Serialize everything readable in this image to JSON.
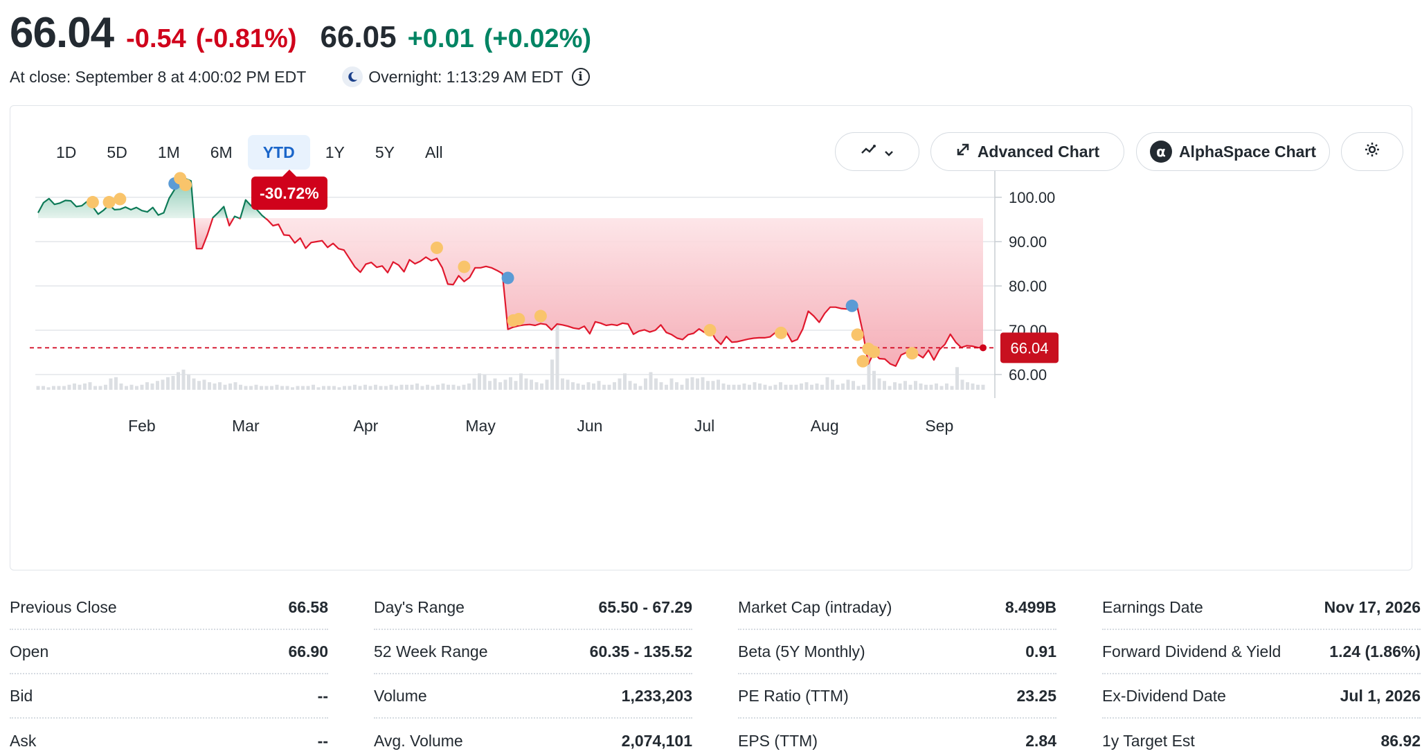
{
  "quote": {
    "price": "66.04",
    "change": "-0.54",
    "change_pct": "(-0.81%)",
    "overnight_price": "66.05",
    "overnight_change": "+0.01",
    "overnight_change_pct": "(+0.02%)",
    "close_text": "At close: September 8 at 4:00:02 PM EDT",
    "overnight_text": "Overnight: 1:13:29 AM EDT"
  },
  "range_tabs": [
    {
      "label": "1D",
      "active": false
    },
    {
      "label": "5D",
      "active": false
    },
    {
      "label": "1M",
      "active": false
    },
    {
      "label": "6M",
      "active": false
    },
    {
      "label": "YTD",
      "active": true
    },
    {
      "label": "1Y",
      "active": false
    },
    {
      "label": "5Y",
      "active": false
    },
    {
      "label": "All",
      "active": false
    }
  ],
  "toolbar": {
    "advanced_label": "Advanced Chart",
    "alpha_label": "AlphaSpace Chart",
    "alpha_glyph": "α",
    "chart_type_icon": "chart-type-icon",
    "settings_icon": "gear-icon"
  },
  "badge": {
    "text": "-30.72%"
  },
  "colors": {
    "negative": "#d0021b",
    "positive": "#008463",
    "active_tab": "#1a65c9",
    "event_yellow": "#f9c46b",
    "event_blue": "#5b9bd5"
  },
  "chart_data": {
    "type": "area",
    "title": "",
    "xlabel": "",
    "ylabel": "",
    "y_ticks": [
      "100.00",
      "90.00",
      "80.00",
      "70.00",
      "60.00"
    ],
    "ylim": [
      55,
      105
    ],
    "x_labels": [
      "Feb",
      "Mar",
      "Apr",
      "May",
      "Jun",
      "Jul",
      "Aug",
      "Sep"
    ],
    "x_label_index": [
      19,
      38,
      60,
      81,
      101,
      122,
      144,
      165
    ],
    "baseline": 95.3,
    "last_value_label": "66.04",
    "last_value": 66.04,
    "prices": [
      96.5,
      98.8,
      99.7,
      98.4,
      98.7,
      99.3,
      99.2,
      97.9,
      98.1,
      99.1,
      97.9,
      96.2,
      97.1,
      98.3,
      97.2,
      97.3,
      97.8,
      97.2,
      97.7,
      97.0,
      96.7,
      97.7,
      96.0,
      96.5,
      99.8,
      101.8,
      102.8,
      104.2,
      103.7,
      88.4,
      88.4,
      91.6,
      95.4,
      96.6,
      97.9,
      93.6,
      95.7,
      95.2,
      99.4,
      98.1,
      97.3,
      95.9,
      94.9,
      93.6,
      93.9,
      91.5,
      91.4,
      89.7,
      90.8,
      88.5,
      89.8,
      90.0,
      90.2,
      88.7,
      89.6,
      88.4,
      88.1,
      86.2,
      84.3,
      83.1,
      84.9,
      85.3,
      84.2,
      84.5,
      83.0,
      85.4,
      84.7,
      83.2,
      85.9,
      85.0,
      85.6,
      86.5,
      85.7,
      86.2,
      84.1,
      80.4,
      80.3,
      82.3,
      81.0,
      81.9,
      84.1,
      84.1,
      84.4,
      84.1,
      83.5,
      82.8,
      70.2,
      70.7,
      71.0,
      71.2,
      71.3,
      71.1,
      71.5,
      71.3,
      70.1,
      71.4,
      71.2,
      70.9,
      70.5,
      70.3,
      70.9,
      69.2,
      71.9,
      71.6,
      71.1,
      71.3,
      71.1,
      71.6,
      71.4,
      69.1,
      69.8,
      70.1,
      69.6,
      70.0,
      71.2,
      69.5,
      69.0,
      68.2,
      67.9,
      69.0,
      69.3,
      70.3,
      69.5,
      70.3,
      68.0,
      66.8,
      68.6,
      67.3,
      67.4,
      67.7,
      68.0,
      68.2,
      68.3,
      68.3,
      68.5,
      69.5,
      68.3,
      69.6,
      67.4,
      67.9,
      70.3,
      74.3,
      73.2,
      71.8,
      73.8,
      75.2,
      75.2,
      74.9,
      74.8,
      76.0,
      75.1,
      69.5,
      62.4,
      64.9,
      63.6,
      63.5,
      62.4,
      61.9,
      64.4,
      65.0,
      65.0,
      64.6,
      63.8,
      65.5,
      63.3,
      65.6,
      66.8,
      69.1,
      67.3,
      66.1,
      66.5,
      66.4,
      66.1,
      66.04
    ],
    "volume": [
      3,
      3,
      2,
      3,
      3,
      3,
      4,
      5,
      4,
      5,
      6,
      3,
      3,
      4,
      9,
      10,
      5,
      3,
      4,
      3,
      4,
      6,
      5,
      7,
      8,
      10,
      11,
      14,
      16,
      12,
      9,
      7,
      8,
      6,
      5,
      6,
      4,
      5,
      6,
      4,
      3,
      3,
      4,
      3,
      3,
      3,
      4,
      3,
      3,
      2,
      3,
      3,
      3,
      4,
      2,
      3,
      3,
      3,
      2,
      3,
      3,
      4,
      3,
      4,
      3,
      4,
      3,
      3,
      4,
      3,
      4,
      4,
      4,
      5,
      3,
      4,
      3,
      4,
      5,
      4,
      4,
      3,
      4,
      5,
      9,
      13,
      12,
      7,
      9,
      6,
      8,
      10,
      7,
      13,
      9,
      8,
      6,
      5,
      8,
      24,
      55,
      9,
      8,
      6,
      5,
      4,
      6,
      5,
      7,
      4,
      4,
      6,
      9,
      13,
      7,
      5,
      3,
      9,
      14,
      9,
      6,
      4,
      9,
      6,
      4,
      9,
      10,
      9,
      10,
      7,
      7,
      8,
      5,
      4,
      4,
      4,
      5,
      4,
      6,
      5,
      4,
      3,
      4,
      6,
      4,
      4,
      4,
      5,
      6,
      4,
      5,
      4,
      10,
      8,
      4,
      5,
      8,
      7,
      3,
      4,
      22,
      15,
      9,
      7,
      3,
      6,
      5,
      7,
      4,
      7,
      5,
      4,
      4,
      5,
      3,
      5,
      3,
      18,
      8,
      6,
      5,
      4,
      4
    ],
    "events": [
      {
        "i": 10,
        "v": 98.9,
        "kind": "yellow"
      },
      {
        "i": 13,
        "v": 98.9,
        "kind": "yellow"
      },
      {
        "i": 15,
        "v": 99.6,
        "kind": "yellow"
      },
      {
        "i": 25,
        "v": 103.1,
        "kind": "blue"
      },
      {
        "i": 26,
        "v": 104.3,
        "kind": "yellow"
      },
      {
        "i": 27,
        "v": 102.8,
        "kind": "yellow"
      },
      {
        "i": 73,
        "v": 88.6,
        "kind": "yellow"
      },
      {
        "i": 78,
        "v": 84.3,
        "kind": "yellow"
      },
      {
        "i": 86,
        "v": 81.8,
        "kind": "blue"
      },
      {
        "i": 87,
        "v": 72.2,
        "kind": "yellow"
      },
      {
        "i": 88,
        "v": 72.5,
        "kind": "yellow"
      },
      {
        "i": 92,
        "v": 73.2,
        "kind": "yellow"
      },
      {
        "i": 123,
        "v": 70.0,
        "kind": "yellow"
      },
      {
        "i": 136,
        "v": 69.4,
        "kind": "yellow"
      },
      {
        "i": 149,
        "v": 75.5,
        "kind": "blue"
      },
      {
        "i": 150,
        "v": 69.0,
        "kind": "yellow"
      },
      {
        "i": 151,
        "v": 63.0,
        "kind": "yellow"
      },
      {
        "i": 152,
        "v": 65.8,
        "kind": "yellow"
      },
      {
        "i": 153,
        "v": 65.1,
        "kind": "yellow"
      },
      {
        "i": 160,
        "v": 64.8,
        "kind": "yellow"
      }
    ]
  },
  "stats": [
    [
      {
        "label": "Previous Close",
        "value": "66.58"
      },
      {
        "label": "Open",
        "value": "66.90"
      },
      {
        "label": "Bid",
        "value": "--"
      },
      {
        "label": "Ask",
        "value": "--"
      }
    ],
    [
      {
        "label": "Day's Range",
        "value": "65.50 - 67.29"
      },
      {
        "label": "52 Week Range",
        "value": "60.35 - 135.52"
      },
      {
        "label": "Volume",
        "value": "1,233,203"
      },
      {
        "label": "Avg. Volume",
        "value": "2,074,101"
      }
    ],
    [
      {
        "label": "Market Cap (intraday)",
        "value": "8.499B"
      },
      {
        "label": "Beta (5Y Monthly)",
        "value": "0.91"
      },
      {
        "label": "PE Ratio (TTM)",
        "value": "23.25"
      },
      {
        "label": "EPS (TTM)",
        "value": "2.84"
      }
    ],
    [
      {
        "label": "Earnings Date",
        "value": "Nov 17, 2026"
      },
      {
        "label": "Forward Dividend & Yield",
        "value": "1.24 (1.86%)"
      },
      {
        "label": "Ex-Dividend Date",
        "value": "Jul 1, 2026"
      },
      {
        "label": "1y Target Est",
        "value": "86.92"
      }
    ]
  ]
}
